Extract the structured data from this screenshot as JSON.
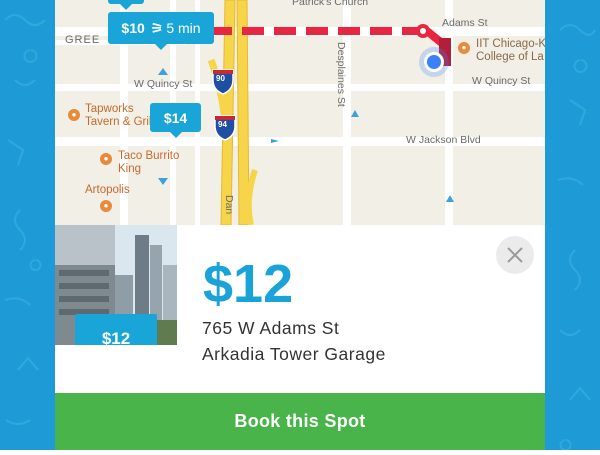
{
  "map": {
    "street_labels": {
      "adams": "Adams St",
      "quincy_left": "W Quincy St",
      "quincy_right": "W Quincy St",
      "jackson": "W Jackson Blvd",
      "desplaines": "Desplaines St",
      "dan": "Dan",
      "greek": "GREE",
      "church": "Patrick's Church"
    },
    "shields": {
      "i90": "90",
      "i94": "94"
    },
    "pois": [
      {
        "label_lines": [
          "Tapworks",
          "Tavern & Grill"
        ]
      },
      {
        "label_lines": [
          "Taco Burrito",
          "King"
        ]
      },
      {
        "label_lines": [
          "Artopolis"
        ]
      },
      {
        "label_lines": [
          "IIT Chicago-K",
          "College of La"
        ]
      }
    ],
    "price_pins": [
      {
        "label": "$10",
        "walk_time": "5 min"
      },
      {
        "label": "$14"
      }
    ],
    "colors": {
      "route": "#e8263f",
      "pin": "#19a5d8",
      "highway": "#f6d54b",
      "location": "#3b82f6"
    }
  },
  "card": {
    "price": "$12",
    "address": "765 W Adams St",
    "name": "Arkadia Tower Garage",
    "photo_pin_label": "$12",
    "close_icon": "close-icon"
  },
  "book_button": {
    "label": "Book this Spot",
    "color": "#48b449"
  }
}
